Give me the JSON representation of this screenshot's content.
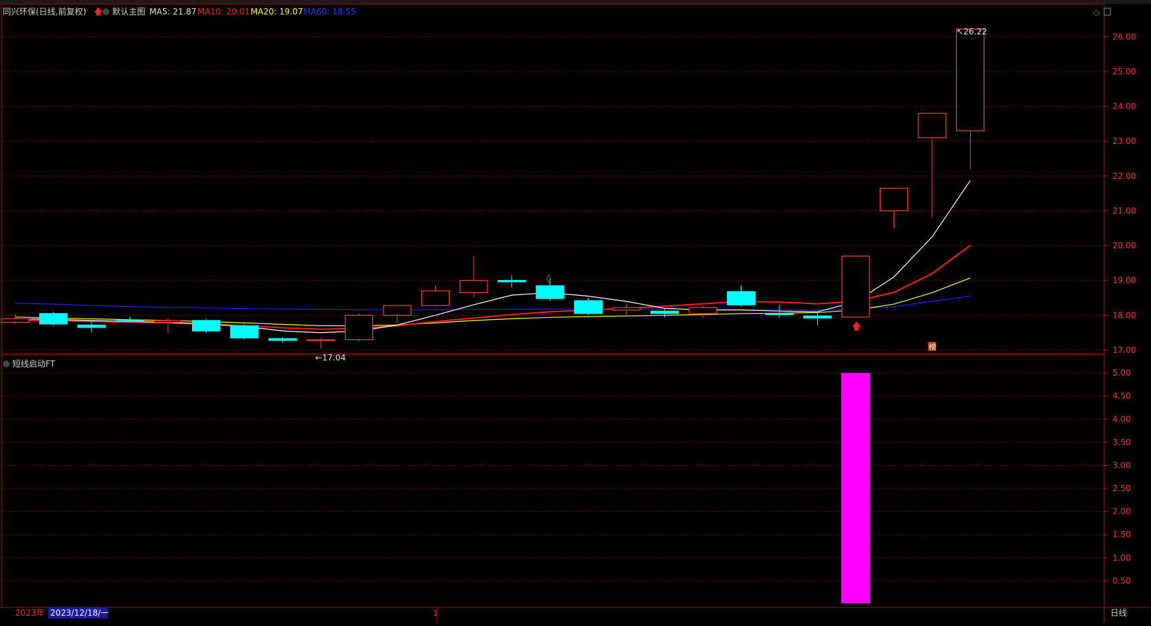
{
  "header": {
    "stock_name": "同兴环保(日线,前复权)",
    "main_chart_label": "默认主图",
    "ma5": "MA5: 21.87",
    "ma10": "MA10: 20.01",
    "ma20": "MA20: 19.07",
    "ma60": "MA60: 18.55"
  },
  "colors": {
    "up": "#ff3b3b",
    "down": "#00ffff",
    "ma5": "#ffffff",
    "ma10": "#ff1a1a",
    "ma20": "#ffff00",
    "ma60": "#2020ff",
    "indicator": "#ff00ff",
    "grid": "#8b0000"
  },
  "annotations": {
    "low_label": "17.04",
    "high_label": "26.22",
    "bang_badge": "榜"
  },
  "indicator_panel": {
    "title": "短线启动FT"
  },
  "bottom_bar": {
    "year_label": "2023年",
    "date_label": "2023/12/18/一",
    "mid_tick": "1",
    "period_label": "日线"
  },
  "chart_data": [
    {
      "type": "candlestick",
      "ylim": [
        16.9,
        26.5
      ],
      "y_ticks": [
        "26.00",
        "25.00",
        "24.00",
        "23.00",
        "22.00",
        "21.00",
        "20.00",
        "19.00",
        "18.00",
        "17.00"
      ],
      "candles": [
        {
          "open": 17.8,
          "close": 17.9,
          "high": 18.05,
          "low": 17.75
        },
        {
          "open": 18.05,
          "close": 17.75,
          "high": 18.1,
          "low": 17.7
        },
        {
          "open": 17.72,
          "close": 17.65,
          "high": 17.85,
          "low": 17.5
        },
        {
          "open": 17.85,
          "close": 17.82,
          "high": 17.95,
          "low": 17.78
        },
        {
          "open": 17.8,
          "close": 17.85,
          "high": 17.92,
          "low": 17.48
        },
        {
          "open": 17.85,
          "close": 17.55,
          "high": 17.9,
          "low": 17.5
        },
        {
          "open": 17.7,
          "close": 17.35,
          "high": 17.75,
          "low": 17.3
        },
        {
          "open": 17.33,
          "close": 17.28,
          "high": 17.36,
          "low": 17.22
        },
        {
          "open": 17.28,
          "close": 17.3,
          "high": 17.35,
          "low": 17.04
        },
        {
          "open": 17.3,
          "close": 18.0,
          "high": 18.05,
          "low": 17.25
        },
        {
          "open": 18.0,
          "close": 18.28,
          "high": 18.3,
          "low": 17.75
        },
        {
          "open": 18.28,
          "close": 18.7,
          "high": 18.85,
          "low": 18.25
        },
        {
          "open": 18.65,
          "close": 19.0,
          "high": 19.7,
          "low": 18.5
        },
        {
          "open": 19.0,
          "close": 18.96,
          "high": 19.15,
          "low": 18.8
        },
        {
          "open": 18.85,
          "close": 18.48,
          "high": 19.05,
          "low": 18.4
        },
        {
          "open": 18.42,
          "close": 18.05,
          "high": 18.5,
          "low": 18.0
        },
        {
          "open": 18.15,
          "close": 18.22,
          "high": 18.35,
          "low": 18.0
        },
        {
          "open": 18.12,
          "close": 18.05,
          "high": 18.2,
          "low": 17.95
        },
        {
          "open": 18.05,
          "close": 18.22,
          "high": 18.28,
          "low": 17.92
        },
        {
          "open": 18.68,
          "close": 18.3,
          "high": 18.85,
          "low": 18.25
        },
        {
          "open": 18.05,
          "close": 18.02,
          "high": 18.3,
          "low": 17.92
        },
        {
          "open": 17.98,
          "close": 17.92,
          "high": 18.1,
          "low": 17.7
        },
        {
          "open": 17.95,
          "close": 19.7,
          "high": 19.7,
          "low": 17.95
        },
        {
          "open": 21.0,
          "close": 21.65,
          "high": 21.65,
          "low": 20.5
        },
        {
          "open": 23.1,
          "close": 23.8,
          "high": 23.8,
          "low": 20.8
        },
        {
          "open": 23.3,
          "close": 26.22,
          "high": 26.22,
          "low": 22.2
        }
      ],
      "ma5": [
        17.9,
        17.88,
        17.85,
        17.82,
        17.8,
        17.75,
        17.68,
        17.55,
        17.5,
        17.55,
        17.72,
        18.0,
        18.3,
        18.58,
        18.65,
        18.55,
        18.4,
        18.2,
        18.15,
        18.15,
        18.12,
        18.1,
        18.38,
        19.1,
        20.25,
        21.87
      ],
      "ma10": [
        17.85,
        17.84,
        17.82,
        17.8,
        17.78,
        17.74,
        17.7,
        17.64,
        17.6,
        17.62,
        17.7,
        17.82,
        17.92,
        18.02,
        18.1,
        18.15,
        18.2,
        18.26,
        18.33,
        18.4,
        18.38,
        18.33,
        18.4,
        18.66,
        19.2,
        20.01
      ],
      "ma20": [
        17.95,
        17.92,
        17.9,
        17.87,
        17.85,
        17.82,
        17.78,
        17.74,
        17.7,
        17.7,
        17.72,
        17.78,
        17.85,
        17.9,
        17.94,
        17.96,
        17.98,
        18.0,
        18.02,
        18.05,
        18.06,
        18.08,
        18.15,
        18.32,
        18.65,
        19.07
      ],
      "ma60": [
        18.35,
        18.32,
        18.28,
        18.25,
        18.23,
        18.21,
        18.19,
        18.18,
        18.17,
        18.16,
        18.16,
        18.16,
        18.17,
        18.17,
        18.18,
        18.18,
        18.18,
        18.18,
        18.17,
        18.17,
        18.16,
        18.15,
        18.18,
        18.25,
        18.4,
        18.55
      ]
    },
    {
      "type": "bar",
      "title": "短线启动FT",
      "ylim": [
        0,
        5.3
      ],
      "y_ticks": [
        "5.00",
        "4.50",
        "4.00",
        "3.50",
        "3.00",
        "2.50",
        "2.00",
        "1.50",
        "1.00",
        "0.50"
      ],
      "values": [
        0,
        0,
        0,
        0,
        0,
        0,
        0,
        0,
        0,
        0,
        0,
        0,
        0,
        0,
        0,
        0,
        0,
        0,
        0,
        0,
        0,
        0,
        5.0,
        0,
        0,
        0
      ]
    }
  ]
}
